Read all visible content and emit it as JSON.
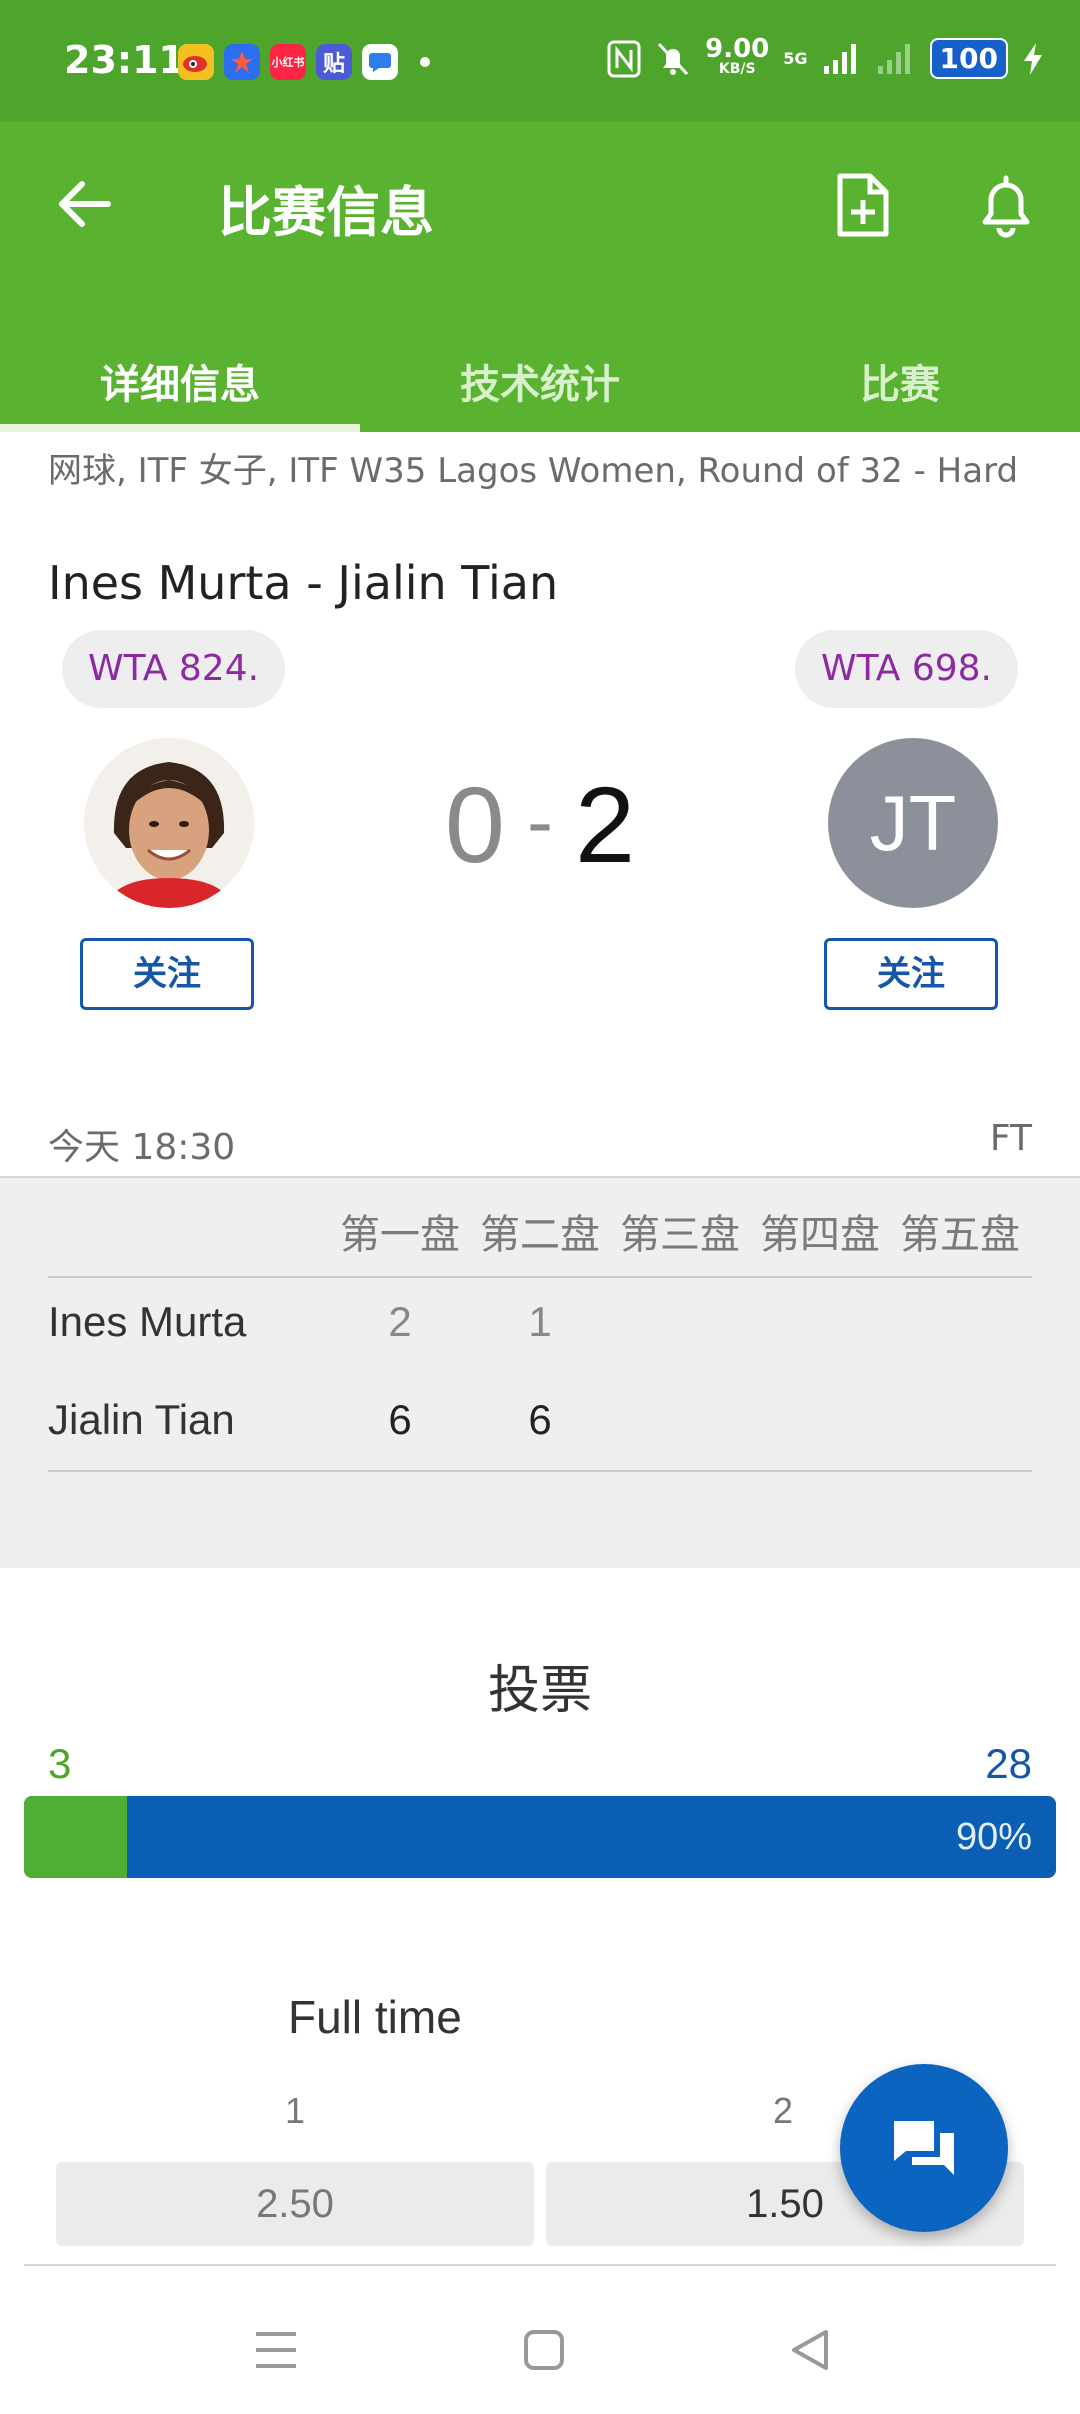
{
  "status_bar": {
    "time": "23:11",
    "net_speed_value": "9.00",
    "net_speed_unit": "KB/S",
    "signal_label": "5G",
    "battery": "100",
    "app_icons": [
      "weibo-app-icon",
      "star-app-icon",
      "xiaohongshu-app-icon",
      "tieba-app-icon",
      "message-app-icon"
    ],
    "xiaohongshu_text": "小红书",
    "tieba_text": "贴"
  },
  "app_bar": {
    "title": "比赛信息"
  },
  "tabs": [
    {
      "label": "详细信息",
      "active": true
    },
    {
      "label": "技术统计",
      "active": false
    },
    {
      "label": "比赛",
      "active": false
    }
  ],
  "match": {
    "breadcrumb": "网球, ITF 女子, ITF W35 Lagos Women, Round of 32 - Hard",
    "title": "Ines Murta - Jialin Tian",
    "player1": {
      "name": "Ines Murta",
      "ranking": "WTA 824.",
      "follow_label": "关注",
      "score": "0"
    },
    "player2": {
      "name": "Jialin Tian",
      "ranking": "WTA 698.",
      "initials": "JT",
      "follow_label": "关注",
      "score": "2"
    },
    "score_separator": "-",
    "datetime": "今天 18:30",
    "status": "FT"
  },
  "sets": {
    "headers": [
      "第一盘",
      "第二盘",
      "第三盘",
      "第四盘",
      "第五盘"
    ],
    "rows": [
      {
        "name": "Ines Murta",
        "values": [
          "2",
          "1"
        ]
      },
      {
        "name": "Jialin Tian",
        "values": [
          "6",
          "6"
        ]
      }
    ]
  },
  "votes": {
    "title": "投票",
    "left_count": "3",
    "right_count": "28",
    "right_percent_label": "90%",
    "left_fraction": 0.1,
    "left_color": "#4fae33",
    "right_color": "#0a5fb4"
  },
  "odds": {
    "title": "Full time",
    "options": [
      {
        "label": "1",
        "value": "2.50"
      },
      {
        "label": "2",
        "value": "1.50"
      }
    ]
  },
  "colors": {
    "status_bar": "#4ea52c",
    "app_bar": "#59b330",
    "accent_blue": "#1456a8",
    "ranking_text": "#8d2aa3"
  }
}
